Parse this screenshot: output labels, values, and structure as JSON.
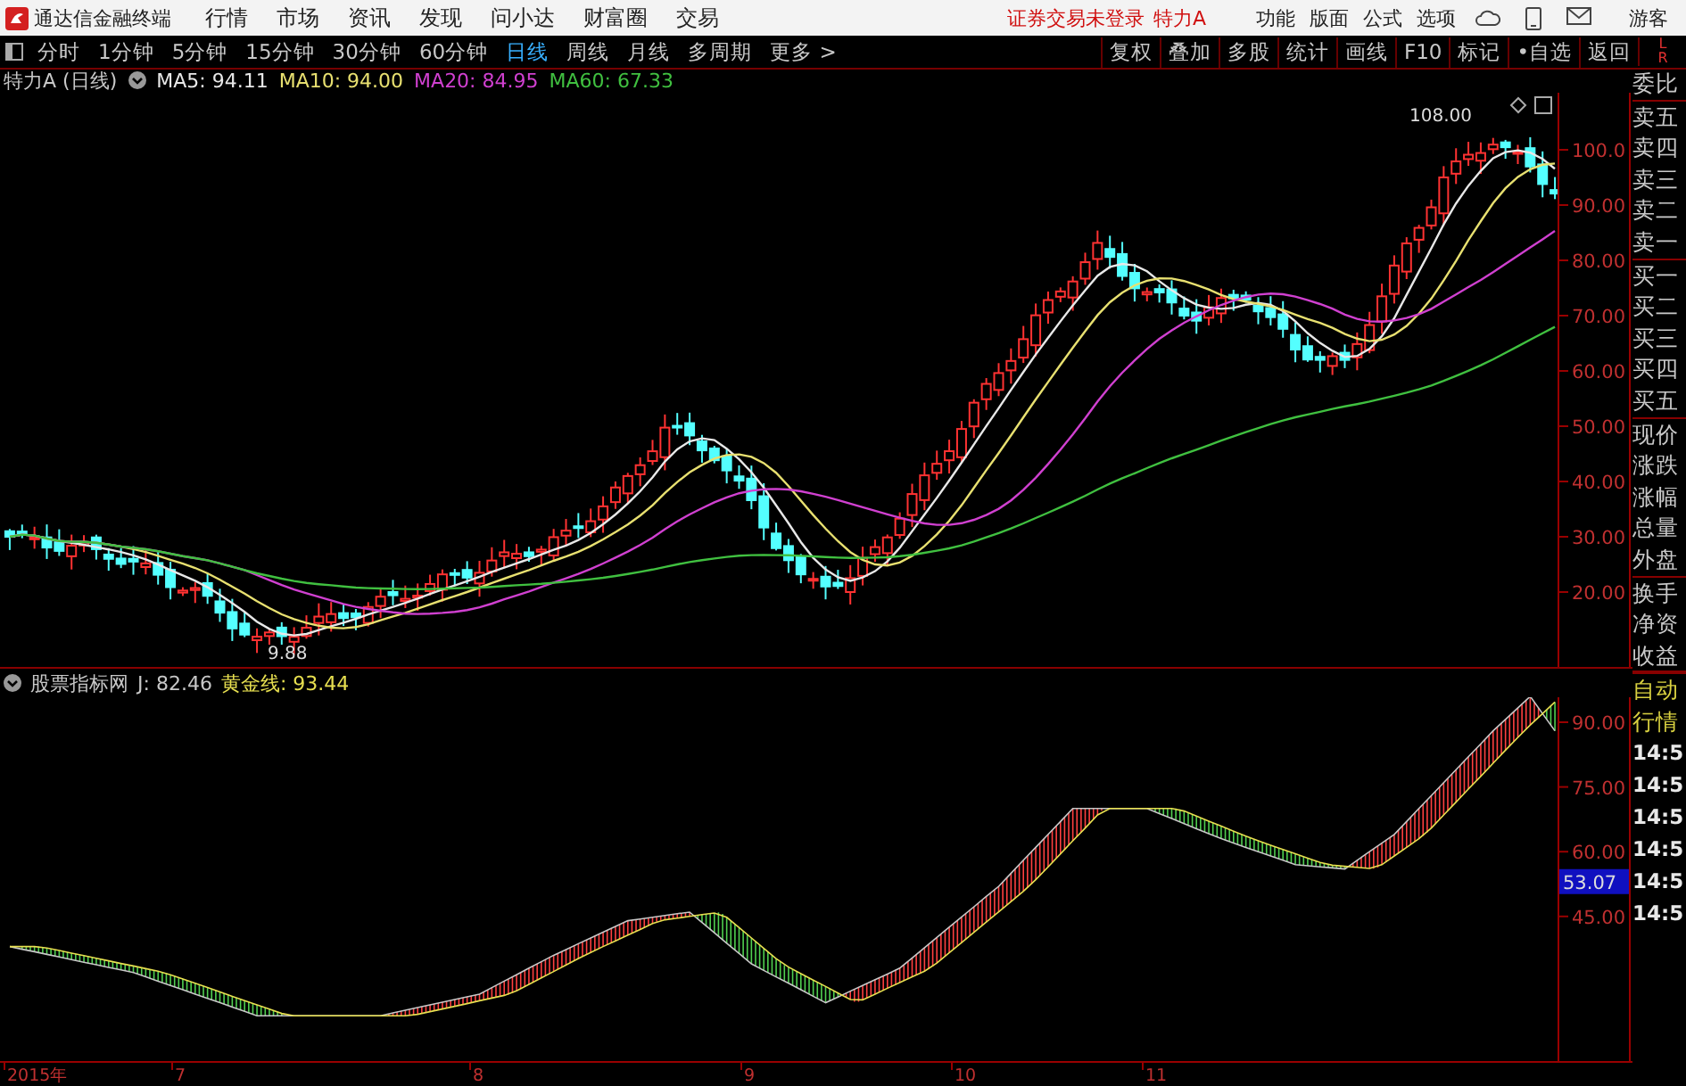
{
  "top_bar": {
    "app_title": "通达信金融终端",
    "menu": [
      "行情",
      "市场",
      "资讯",
      "发现",
      "问小达",
      "财富圈",
      "交易"
    ],
    "login_status": "证券交易未登录",
    "stock_name": "特力A",
    "right_menu": [
      "功能",
      "版面",
      "公式",
      "选项"
    ],
    "user": "游客"
  },
  "toolbar": {
    "periods": [
      {
        "label": "分时",
        "selected": false
      },
      {
        "label": "1分钟",
        "selected": false
      },
      {
        "label": "5分钟",
        "selected": false
      },
      {
        "label": "15分钟",
        "selected": false
      },
      {
        "label": "30分钟",
        "selected": false
      },
      {
        "label": "60分钟",
        "selected": false
      },
      {
        "label": "日线",
        "selected": true
      },
      {
        "label": "周线",
        "selected": false
      },
      {
        "label": "月线",
        "selected": false
      },
      {
        "label": "多周期",
        "selected": false
      },
      {
        "label": "更多 >",
        "selected": false
      }
    ],
    "buttons": [
      "复权",
      "叠加",
      "多股",
      "统计",
      "画线",
      "F10",
      "标记",
      "•自选",
      "返回"
    ],
    "side_tabs": [
      "L",
      "R"
    ]
  },
  "price_chart": {
    "title": "特力A (日线)",
    "indicators": [
      {
        "label": "MA5: 94.11",
        "color": "#e8e8e8"
      },
      {
        "label": "MA10: 94.00",
        "color": "#e8e070"
      },
      {
        "label": "MA20: 84.95",
        "color": "#d040d0"
      },
      {
        "label": "MA60: 67.33",
        "color": "#40c040"
      }
    ],
    "y_axis": [
      "100.0",
      "90.00",
      "80.00",
      "70.00",
      "60.00",
      "50.00",
      "40.00",
      "30.00",
      "20.00"
    ],
    "high_label": "108.00",
    "low_label": "9.88"
  },
  "indicator_panel": {
    "title": "股票指标网",
    "values": [
      {
        "label": "J: 82.46",
        "color": "#c8c8c8"
      },
      {
        "label": "黄金线: 93.44",
        "color": "#e8e050"
      }
    ],
    "y_axis": [
      "90.00",
      "75.00",
      "60.00",
      "45.00"
    ],
    "current_value": "53.07"
  },
  "x_axis": [
    "2015年",
    "7",
    "8",
    "9",
    "10",
    "11"
  ],
  "quote_panel": {
    "fields": [
      "委比",
      "卖五",
      "卖四",
      "卖三",
      "卖二",
      "卖一",
      "买一",
      "买二",
      "买三",
      "买四",
      "买五",
      "现价",
      "涨跌",
      "涨幅",
      "总量",
      "外盘",
      "换手",
      "净资",
      "收益"
    ],
    "mode": [
      "自动",
      "行情"
    ],
    "times": [
      "14:5",
      "14:5",
      "14:5",
      "14:5",
      "14:5",
      "14:5"
    ]
  }
}
